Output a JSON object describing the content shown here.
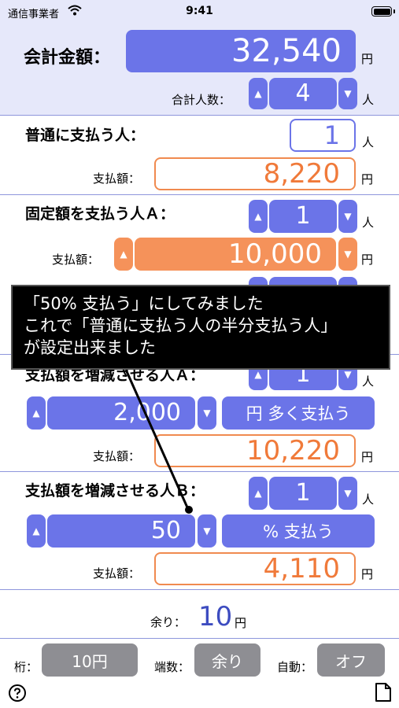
{
  "status": {
    "carrier": "通信事業者",
    "time": "9:41"
  },
  "header": {
    "total_label": "会計金額：",
    "total_value": "32,540",
    "total_unit": "円",
    "people_label": "合計人数：",
    "people_value": "4",
    "people_unit": "人"
  },
  "normal": {
    "label": "普通に支払う人：",
    "count": "1",
    "count_unit": "人",
    "pay_label": "支払額：",
    "pay_value": "8,220",
    "pay_unit": "円"
  },
  "fixedA": {
    "label": "固定額を支払う人Ａ：",
    "count": "1",
    "count_unit": "人",
    "pay_label": "支払額：",
    "pay_value": "10,000",
    "pay_unit": "円"
  },
  "adjustA": {
    "label": "支払額を増減させる人Ａ：",
    "count": "1",
    "count_unit": "人",
    "amount": "2,000",
    "mode": "円 多く支払う",
    "pay_label": "支払額：",
    "pay_value": "10,220",
    "pay_unit": "円"
  },
  "adjustB": {
    "label": "支払額を増減させる人Ｂ：",
    "count": "1",
    "count_unit": "人",
    "amount": "50",
    "mode": "% 支払う",
    "pay_label": "支払額：",
    "pay_value": "4,110",
    "pay_unit": "円"
  },
  "remainder": {
    "label": "余り：",
    "value": "10",
    "unit": "円"
  },
  "footer": {
    "digit_label": "桁：",
    "digit_value": "10円",
    "fraction_label": "端数：",
    "fraction_value": "余り",
    "auto_label": "自動：",
    "auto_value": "オフ"
  },
  "callout": {
    "line1": "「50% 支払う」にしてみました",
    "line2": "これで「普通に支払う人の半分支払う人」",
    "line3": "が設定出来ました"
  },
  "icons": {
    "up": "▲",
    "down": "▼",
    "help": "help-icon",
    "document": "document-icon",
    "wifi": "wifi-icon"
  },
  "colors": {
    "accent": "#6b74e8",
    "orange": "#f5925a",
    "gray": "#8e8e93",
    "header_bg": "#e6e8fa"
  }
}
